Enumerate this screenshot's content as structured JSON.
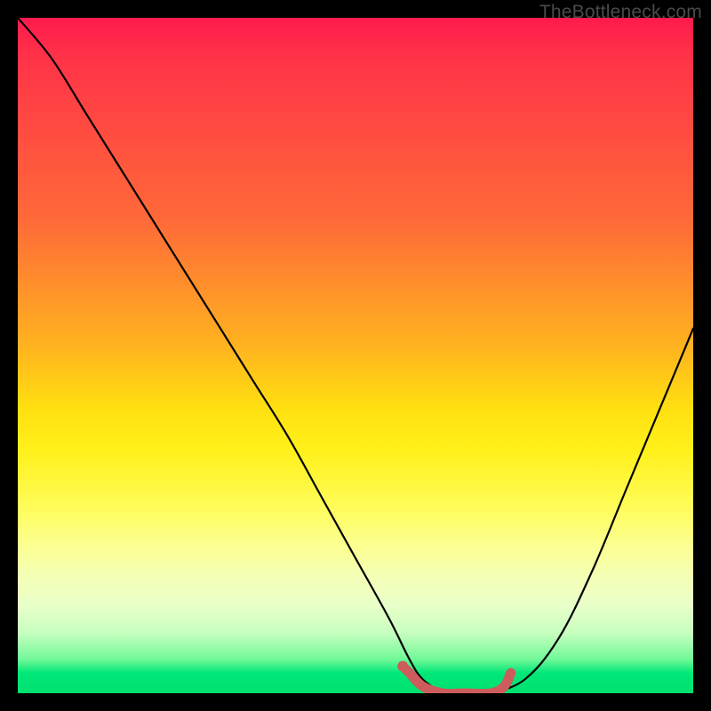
{
  "watermark": "TheBottleneck.com",
  "chart_data": {
    "type": "line",
    "title": "",
    "xlabel": "",
    "ylabel": "",
    "xlim": [
      0,
      100
    ],
    "ylim": [
      0,
      100
    ],
    "grid": false,
    "series": [
      {
        "name": "bottleneck-curve",
        "color": "#000000",
        "x": [
          0,
          5,
          10,
          15,
          20,
          25,
          30,
          35,
          40,
          45,
          50,
          55,
          58,
          60,
          63,
          66,
          70,
          75,
          80,
          85,
          90,
          95,
          100
        ],
        "values": [
          100,
          94,
          86,
          78,
          70,
          62,
          54,
          46,
          38,
          29,
          20,
          11,
          5,
          2,
          0,
          0,
          0,
          2,
          8,
          18,
          30,
          42,
          54
        ]
      },
      {
        "name": "optimal-marker",
        "color": "#cd5c5c",
        "x": [
          57,
          58,
          60,
          63,
          66,
          70,
          72,
          73
        ],
        "values": [
          4,
          3,
          1,
          0,
          0,
          0,
          1,
          3
        ]
      }
    ],
    "annotations": []
  },
  "colors": {
    "background": "#000000",
    "gradient_top": "#ff1a4d",
    "gradient_bottom": "#00e070",
    "curve": "#000000",
    "marker": "#cd5c5c"
  }
}
